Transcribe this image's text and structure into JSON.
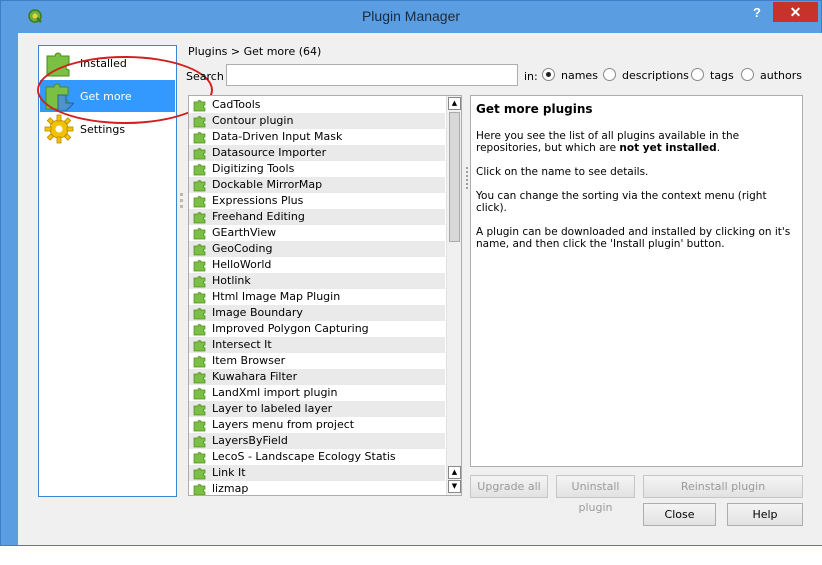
{
  "window": {
    "title": "Plugin Manager",
    "help": "?",
    "close": "✕"
  },
  "sidebar": {
    "items": [
      {
        "label": "Installed",
        "icon": "puzzle-installed-icon"
      },
      {
        "label": "Get more",
        "icon": "puzzle-get-more-icon",
        "selected": true
      },
      {
        "label": "Settings",
        "icon": "gear-settings-icon"
      }
    ]
  },
  "breadcrumb": "Plugins > Get more (64)",
  "search": {
    "label": "Search",
    "value": "",
    "in_label": "in:",
    "options": [
      {
        "label": "names",
        "checked": true
      },
      {
        "label": "descriptions",
        "checked": false
      },
      {
        "label": "tags",
        "checked": false
      },
      {
        "label": "authors",
        "checked": false
      }
    ]
  },
  "plugins": [
    "CadTools",
    "Contour plugin",
    "Data-Driven Input Mask",
    "Datasource Importer",
    "Digitizing Tools",
    "Dockable MirrorMap",
    "Expressions Plus",
    "Freehand Editing",
    "GEarthView",
    "GeoCoding",
    "HelloWorld",
    "Hotlink",
    "Html Image Map Plugin",
    "Image Boundary",
    "Improved Polygon Capturing",
    "Intersect It",
    "Item Browser",
    "Kuwahara Filter",
    "LandXml import plugin",
    "Layer to labeled layer",
    "Layers menu from project",
    "LayersByField",
    "LecoS - Landscape Ecology Statis",
    "Link It",
    "lizmap"
  ],
  "detail": {
    "title": "Get more plugins",
    "p1_pre": "Here you see the list of all plugins available in the repositories, but which are ",
    "p1_bold": "not yet installed",
    "p1_post": ".",
    "p2": "Click on the name to see details.",
    "p3": "You can change the sorting via the context menu (right click).",
    "p4": "A plugin can be downloaded and installed by clicking on it's name, and then click the 'Install plugin' button."
  },
  "buttons": {
    "upgrade_all": "Upgrade all",
    "uninstall": "Uninstall plugin",
    "reinstall": "Reinstall plugin",
    "close": "Close",
    "help": "Help"
  },
  "colors": {
    "accent": "#3399ff",
    "title_bar": "#5a9de0",
    "close_red": "#c7322b",
    "annotation_red": "#d21f1f",
    "puzzle_green": "#7bc043",
    "gear_yellow": "#f2c200"
  }
}
